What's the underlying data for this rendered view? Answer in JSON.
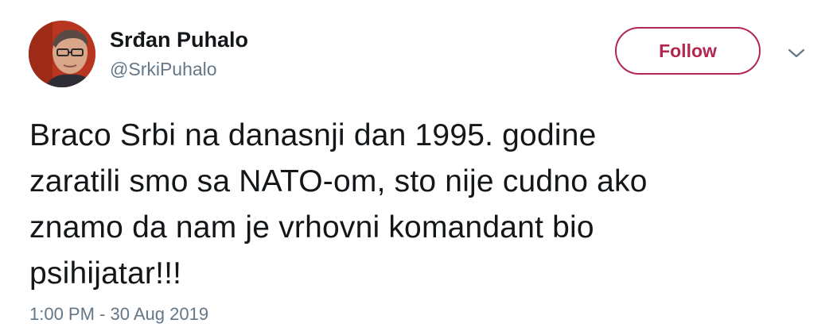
{
  "author": {
    "display_name": "Srđan Puhalo",
    "handle": "@SrkiPuhalo",
    "avatar_icon": "user-avatar-photo"
  },
  "actions": {
    "follow_label": "Follow",
    "more_icon": "chevron-down-icon"
  },
  "tweet": {
    "text": "Braco Srbi na danasnji dan 1995. godine\nzaratili smo sa NATO-om, sto nije cudno ako\nznamo da nam je vrhovni komandant bio\npsihijatar!!!",
    "timestamp": "1:00 PM - 30 Aug 2019"
  },
  "colors": {
    "follow_accent": "#b3264f",
    "secondary_text": "#657786",
    "primary_text": "#14171a"
  }
}
